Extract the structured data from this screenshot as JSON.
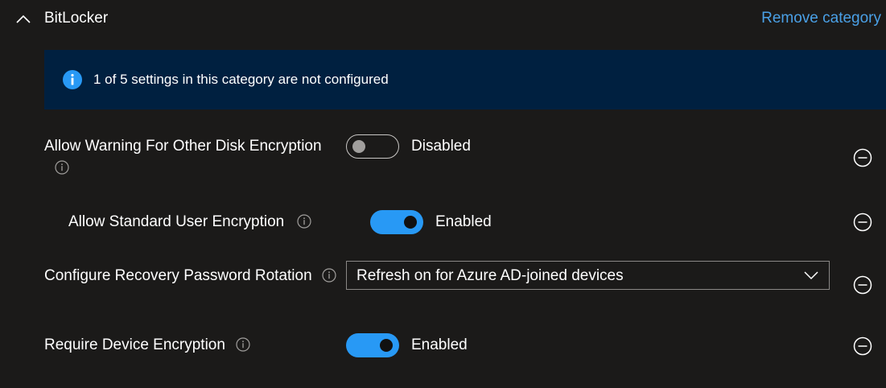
{
  "category": {
    "title": "BitLocker",
    "remove_label": "Remove category",
    "accent_color": "#4aa0e6"
  },
  "banner": {
    "text": "1 of 5 settings in this category are not configured",
    "icon": "info-icon",
    "background": "#002040"
  },
  "settings": [
    {
      "label": "Allow Warning For Other Disk Encryption",
      "control": "toggle",
      "enabled": false,
      "state_label": "Disabled"
    },
    {
      "label": "Allow Standard User Encryption",
      "control": "toggle",
      "enabled": true,
      "state_label": "Enabled"
    },
    {
      "label": "Configure Recovery Password Rotation",
      "control": "dropdown",
      "selected": "Refresh on for Azure AD-joined devices"
    },
    {
      "label": "Require Device Encryption",
      "control": "toggle",
      "enabled": true,
      "state_label": "Enabled"
    }
  ]
}
